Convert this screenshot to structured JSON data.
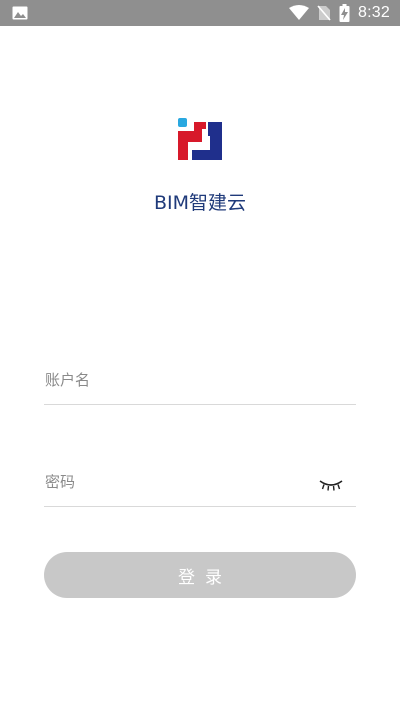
{
  "status_bar": {
    "time": "8:32",
    "icons": [
      "image-icon",
      "wifi-icon",
      "no-sim-icon",
      "battery-charging-icon"
    ]
  },
  "app": {
    "logo": "bim-logo",
    "title": "BIM智建云",
    "brand_colors": {
      "red": "#d7192a",
      "blue": "#1f2f8c",
      "cyan": "#29a8e0"
    }
  },
  "login_form": {
    "username_placeholder": "账户名",
    "password_placeholder": "密码",
    "toggle_visibility_icon": "eye-closed-icon",
    "submit_label": "登录",
    "submit_color": "#c8c8c8"
  }
}
